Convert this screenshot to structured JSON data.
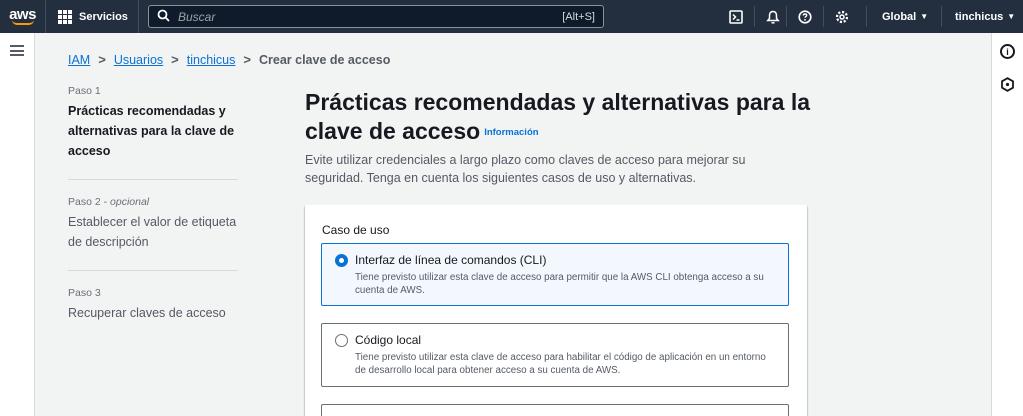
{
  "topnav": {
    "logo_text": "aws",
    "services_label": "Servicios",
    "search_placeholder": "Buscar",
    "search_shortcut": "[Alt+S]",
    "icons": [
      "cloudshell-icon",
      "notifications-icon",
      "help-icon",
      "settings-icon"
    ],
    "region_label": "Global",
    "user_label": "tinchicus"
  },
  "breadcrumb": {
    "items": [
      "IAM",
      "Usuarios",
      "tinchicus"
    ],
    "current": "Crear clave de acceso"
  },
  "steps": [
    {
      "label": "Paso 1",
      "optional": "",
      "title": "Prácticas recomendadas y alternativas para la clave de acceso"
    },
    {
      "label": "Paso 2 -",
      "optional": "opcional",
      "title": "Establecer el valor de etiqueta de descripción"
    },
    {
      "label": "Paso 3",
      "optional": "",
      "title": "Recuperar claves de acceso"
    }
  ],
  "main": {
    "title": "Prácticas recomendadas y alternativas para la clave de acceso",
    "info_link": "Información",
    "description": "Evite utilizar credenciales a largo plazo como claves de acceso para mejorar su seguridad. Tenga en cuenta los siguientes casos de uso y alternativas.",
    "use_case_label": "Caso de uso",
    "options": [
      {
        "title": "Interfaz de línea de comandos (CLI)",
        "description": "Tiene previsto utilizar esta clave de acceso para permitir que la AWS CLI obtenga acceso a su cuenta de AWS.",
        "selected": true
      },
      {
        "title": "Código local",
        "description": "Tiene previsto utilizar esta clave de acceso para habilitar el código de aplicación en un entorno de desarrollo local para obtener acceso a su cuenta de AWS.",
        "selected": false
      }
    ]
  },
  "colors": {
    "nav_bg": "#232f3e",
    "link": "#0972d3",
    "accent_orange": "#ff9900",
    "page_bg": "#f2f3f3"
  }
}
